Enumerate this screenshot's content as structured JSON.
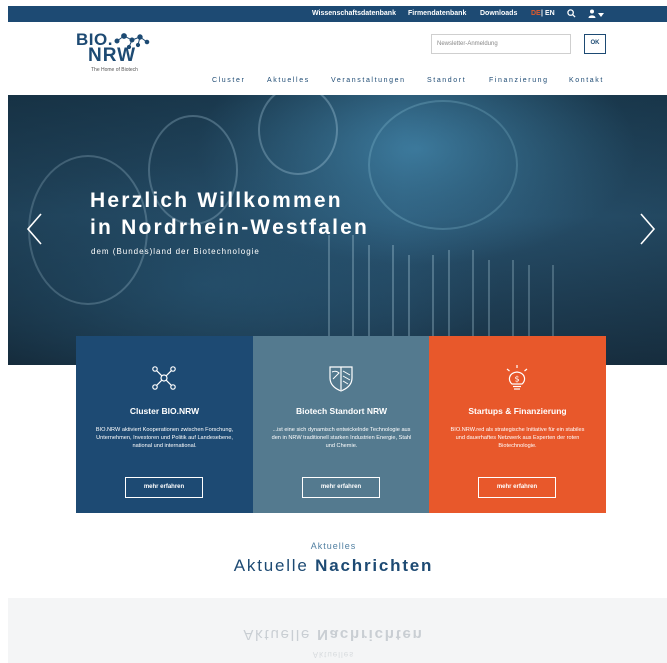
{
  "topbar": {
    "links": [
      "Wissenschaftsdatenbank",
      "Firmendatenbank",
      "Downloads"
    ],
    "lang_de": "DE",
    "lang_sep": "|",
    "lang_en": "EN",
    "icons": [
      "search-icon",
      "user-icon",
      "caret-down-icon"
    ]
  },
  "logo": {
    "line1": "BIO.",
    "line2": "NRW",
    "tagline": "The Home of Biotech"
  },
  "newsletter": {
    "placeholder": "Newsletter-Anmeldung",
    "ok_label": "OK"
  },
  "nav": {
    "items": [
      "Cluster",
      "Aktuelles",
      "Veranstaltungen",
      "Standort",
      "Finanzierung",
      "Kontakt"
    ]
  },
  "hero": {
    "title_line1": "Herzlich Willkommen",
    "title_line2": "in Nordrhein-Westfalen",
    "subtitle": "dem (Bundes)land der Biotechnologie",
    "icons": [
      "chevron-left-icon",
      "chevron-right-icon"
    ]
  },
  "cards": [
    {
      "icon": "network-icon",
      "title": "Cluster BIO.NRW",
      "text": "BIO.NRW aktiviert Kooperationen zwischen Forschung, Unternehmen, Investoren und Politik auf Landesebene, national und international.",
      "button": "mehr erfahren",
      "color": "#1d4a73"
    },
    {
      "icon": "nrw-crest-icon",
      "title": "Biotech Standort NRW",
      "text": "...ist eine sich dynamisch entwickelnde Technologie aus den in NRW traditionell starken Industrien Energie, Stahl und Chemie.",
      "button": "mehr erfahren",
      "color": "#547a8f"
    },
    {
      "icon": "money-bulb-icon",
      "title": "Startups & Finanzierung",
      "text": "BIO.NRW.red als strategische Initiative für ein stabiles und dauerhaftes Netzwerk aus Experten der roten Biotechnologie.",
      "button": "mehr erfahren",
      "color": "#e8582b"
    }
  ],
  "news": {
    "kicker": "Aktuelles",
    "title_light": "Aktuelle",
    "title_bold": "Nachrichten"
  },
  "colors": {
    "brand_blue": "#1d4a73",
    "accent_orange": "#e8582b",
    "slate": "#547a8f"
  }
}
